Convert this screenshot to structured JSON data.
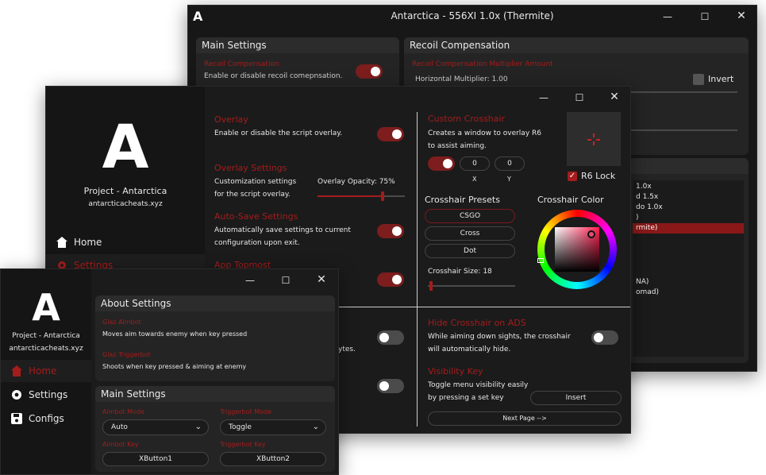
{
  "back_window": {
    "logo": "A",
    "title": "Antarctica - 556XI 1.0x (Thermite)",
    "main_settings": {
      "title": "Main Settings",
      "recoil_label": "Recoil Compensation",
      "recoil_desc": "Enable or disable recoil comepnsation."
    },
    "recoil_panel": {
      "title": "Recoil Compensation",
      "multiplier_label": "Recoil Compensation Multiplier Amount",
      "horizontal_label": "Horizontal Multiplier: 1.00",
      "invert_label": "Invert"
    },
    "preset_list": [
      "1.0x",
      "d 1.5x",
      "do 1.0x",
      ")",
      "rmite)",
      "",
      "",
      "",
      "",
      "NA)",
      "omad)"
    ]
  },
  "mid_window": {
    "logo": "A",
    "project_name": "Project - Antarctica",
    "site": "antarcticacheats.xyz",
    "nav": {
      "home": "Home",
      "settings": "Settings"
    },
    "overlay": {
      "label": "Overlay",
      "desc": "Enable or disable the script overlay."
    },
    "overlay_settings": {
      "label": "Overlay Settings",
      "desc_line1": "Customization settings",
      "desc_line2": "for the script overlay.",
      "opacity_label": "Overlay Opacity: 75%",
      "opacity_value": 75
    },
    "auto_save": {
      "label": "Auto-Save Settings",
      "desc_line1": "Automatically save settings to current",
      "desc_line2": "configuration upon exit."
    },
    "app_topmost": {
      "label": "App Topmost"
    },
    "partial_text": "ytes.",
    "custom_crosshair": {
      "label": "Custom Crosshair",
      "desc_line1": "Creates a window to overlay R6",
      "desc_line2": "to assist aiming.",
      "x_value": "0",
      "y_value": "0",
      "x_label": "X",
      "y_label": "Y",
      "r6_lock_label": "R6 Lock"
    },
    "crosshair_presets": {
      "title": "Crosshair Presets",
      "items": [
        "CSGO",
        "Cross",
        "Dot"
      ]
    },
    "crosshair_color": {
      "title": "Crosshair Color"
    },
    "crosshair_size": {
      "label": "Crosshair Size: 18"
    },
    "hide_crosshair": {
      "label": "Hide Crosshair on ADS",
      "desc_line1": "While aiming down sights, the crosshair",
      "desc_line2": "will automatically hide."
    },
    "visibility_key": {
      "label": "Visibility Key",
      "desc_line1": "Toggle menu visibility easily",
      "desc_line2": "by pressing a set key",
      "key_value": "Insert"
    },
    "next_page": "Next Page -->"
  },
  "front_window": {
    "logo": "A",
    "project_name": "Project - Antarctica",
    "site": "antarcticacheats.xyz",
    "nav": {
      "home": "Home",
      "settings": "Settings",
      "configs": "Configs"
    },
    "about": {
      "title": "About Settings",
      "aimbot_label": "Glaz Aimbot",
      "aimbot_desc": "Moves aim towards enemy when key pressed",
      "trigger_label": "Glaz Triggerbot",
      "trigger_desc": "Shoots when key pressed & aiming at enemy"
    },
    "main": {
      "title": "Main Settings",
      "aimbot_mode_label": "Aimbot Mode",
      "aimbot_mode_value": "Auto",
      "trigger_mode_label": "Triggerbot Mode",
      "trigger_mode_value": "Toggle",
      "aimbot_key_label": "Aimbot Key",
      "aimbot_key_value": "XButton1",
      "trigger_key_label": "Triggerbot Key",
      "trigger_key_value": "XButton2"
    }
  },
  "colors": {
    "accent": "#a51c1c",
    "bg": "#1b1b1b",
    "panel": "#242424"
  }
}
